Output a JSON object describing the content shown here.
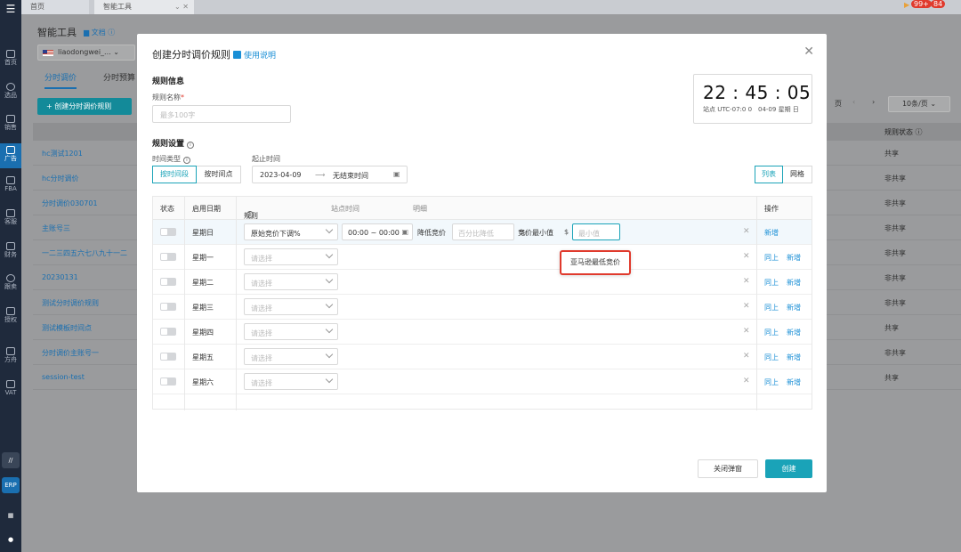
{
  "colors": {
    "accent": "#1aa3b8",
    "link": "#1a8fd6",
    "sidebar": "#1f2a3c",
    "danger": "#e03a2d"
  },
  "sidebar": {
    "items": [
      {
        "label": "首页",
        "icon": "home-icon"
      },
      {
        "label": "选品",
        "icon": "search-icon"
      },
      {
        "label": "销售",
        "icon": "chart-icon"
      },
      {
        "label": "广告",
        "icon": "ad-icon"
      },
      {
        "label": "FBA",
        "icon": "box-icon"
      },
      {
        "label": "客服",
        "icon": "chat-icon"
      },
      {
        "label": "财务",
        "icon": "money-icon"
      },
      {
        "label": "跟卖",
        "icon": "pie-icon"
      },
      {
        "label": "授权",
        "icon": "shield-icon"
      },
      {
        "label": "方舟",
        "icon": "ark-icon"
      },
      {
        "label": "VAT",
        "icon": "building-icon"
      }
    ],
    "erp_label": "ERP"
  },
  "topbar": {
    "tabs": [
      "首页",
      "智能工具"
    ],
    "badges": [
      "99+",
      "84"
    ]
  },
  "background": {
    "title": "智能工具",
    "doc_link": "文档",
    "store": "liaodongwei_...",
    "tabs": [
      "分时调价",
      "分时预算"
    ],
    "create_button": "+ 创建分时调价规则",
    "page_suffix": "页",
    "page_size": "10条/页",
    "status_header": "规则状态",
    "rows": [
      {
        "name": "hc测试1201",
        "status": "共享"
      },
      {
        "name": "hc分时调价",
        "status": "非共享"
      },
      {
        "name": "分时调价030701",
        "status": "非共享"
      },
      {
        "name": "主账号三",
        "status": "非共享"
      },
      {
        "name": "一二三四五六七八九十一二",
        "status": "非共享"
      },
      {
        "name": "20230131",
        "status": "非共享"
      },
      {
        "name": "测试分时调价规则",
        "status": "非共享"
      },
      {
        "name": "测试模板时间点",
        "status": "共享"
      },
      {
        "name": "分时调价主账号一",
        "status": "非共享"
      },
      {
        "name": "session-test",
        "status": "共享"
      }
    ]
  },
  "modal": {
    "title": "创建分时调价规则",
    "help_link": "使用说明",
    "rule_info_section": "规则信息",
    "rule_name_label": "规则名称",
    "rule_name_placeholder": "最多100字",
    "clock": {
      "time": "22 : 45 : 05",
      "site_line": "站点 UTC-07:0 0",
      "date_line": "04-09 星期 日"
    },
    "rule_settings_section": "规则设置",
    "time_type_label": "时间类型",
    "time_type_options": [
      "按时间段",
      "按时间点"
    ],
    "start_end_label": "起止时间",
    "start_date": "2023-04-09",
    "end_date": "无结束时间",
    "view_options": [
      "列表",
      "网格"
    ],
    "columns": [
      "状态",
      "启用日期",
      "规则",
      "站点时间",
      "明细",
      "操作"
    ],
    "rows": [
      {
        "day": "星期日",
        "rule": "原始竞价下调%",
        "filled": true
      },
      {
        "day": "星期一",
        "rule": "请选择",
        "filled": false
      },
      {
        "day": "星期二",
        "rule": "请选择",
        "filled": false
      },
      {
        "day": "星期三",
        "rule": "请选择",
        "filled": false
      },
      {
        "day": "星期四",
        "rule": "请选择",
        "filled": false
      },
      {
        "day": "星期五",
        "rule": "请选择",
        "filled": false
      },
      {
        "day": "星期六",
        "rule": "请选择",
        "filled": false
      }
    ],
    "first_row": {
      "time_range": "00:00 ~ 00:00",
      "lower_bid_label": "降低竞价",
      "percent_placeholder": "百分比降低",
      "percent_unit": "%",
      "min_bid_label": "竞价最小值",
      "currency": "$",
      "min_placeholder": "最小值"
    },
    "action_up": "同上",
    "action_add": "新增",
    "tooltip": "亚马逊最低竞价",
    "close_button": "关闭弹窗",
    "create_button": "创建"
  }
}
